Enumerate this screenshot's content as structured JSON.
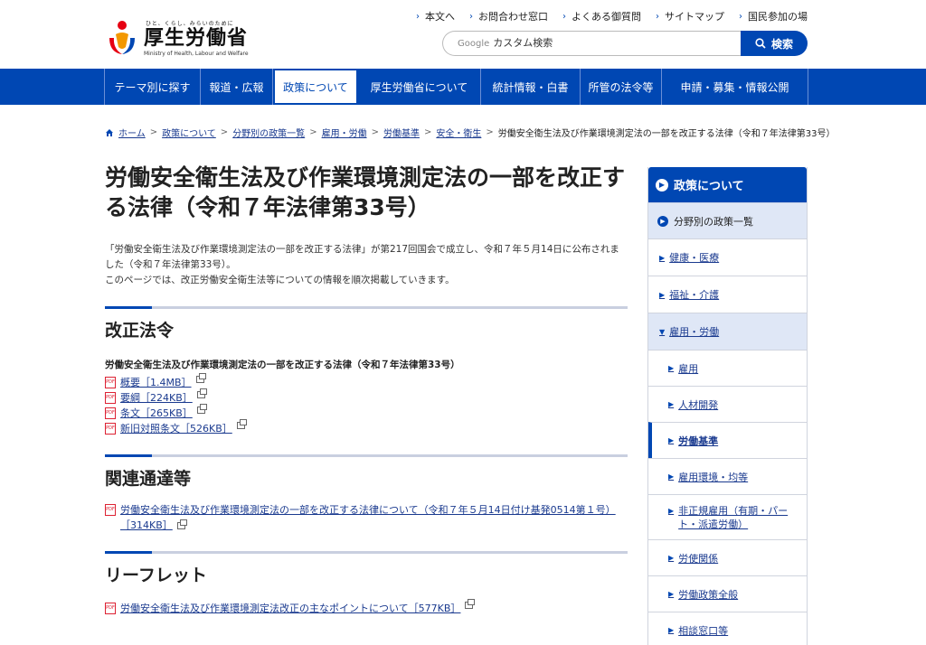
{
  "header": {
    "tagline": "ひと、くらし、みらいのために",
    "site_name": "厚生労働省",
    "site_name_en": "Ministry of Health, Labour and Welfare",
    "util_links": [
      "本文へ",
      "お問合わせ窓口",
      "よくある御質問",
      "サイトマップ",
      "国民参加の場"
    ],
    "search_prefix": "Google",
    "search_placeholder": "カスタム検索",
    "search_button": "検索"
  },
  "gnav": {
    "items": [
      "テーマ別に探す",
      "報道・広報",
      "政策について",
      "厚生労働省について",
      "統計情報・白書",
      "所管の法令等",
      "申請・募集・情報公開"
    ],
    "active_index": 2
  },
  "breadcrumb": [
    "ホーム",
    "政策について",
    "分野別の政策一覧",
    "雇用・労働",
    "労働基準",
    "安全・衛生",
    "労働安全衛生法及び作業環境測定法の一部を改正する法律（令和７年法律第33号）"
  ],
  "main": {
    "title": "労働安全衛生法及び作業環境測定法の一部を改正する法律（令和７年法律第33号）",
    "intro_1": "「労働安全衛生法及び作業環境測定法の一部を改正する法律」が第217回国会で成立し、令和７年５月14日に公布されました（令和７年法律第33号）。",
    "intro_2": "このページでは、改正労働安全衛生法等についての情報を順次掲載していきます。",
    "sections": [
      {
        "heading": "改正法令",
        "subheading": "労働安全衛生法及び作業環境測定法の一部を改正する法律（令和７年法律第33号）",
        "files": [
          "概要［1.4MB］",
          "要綱［224KB］",
          "条文［265KB］",
          "新旧対照条文［526KB］"
        ]
      },
      {
        "heading": "関連通達等",
        "files": [
          "労働安全衛生法及び作業環境測定法の一部を改正する法律について（令和７年５月14日付け基発0514第１号）［314KB］"
        ]
      },
      {
        "heading": "リーフレット",
        "files": [
          "労働安全衛生法及び作業環境測定法改正の主なポイントについて［577KB］"
        ]
      }
    ],
    "pdf_label": "PDF"
  },
  "sidebar": {
    "title": "政策について",
    "sub": "分野別の政策一覧",
    "items": [
      "健康・医療",
      "福祉・介護",
      "雇用・労働"
    ],
    "children": [
      "雇用",
      "人材開発",
      "労働基準",
      "雇用環境・均等",
      "非正規雇用（有期・パート・派遣労働）",
      "労使関係",
      "労働政策全般",
      "相談窓口等"
    ]
  }
}
